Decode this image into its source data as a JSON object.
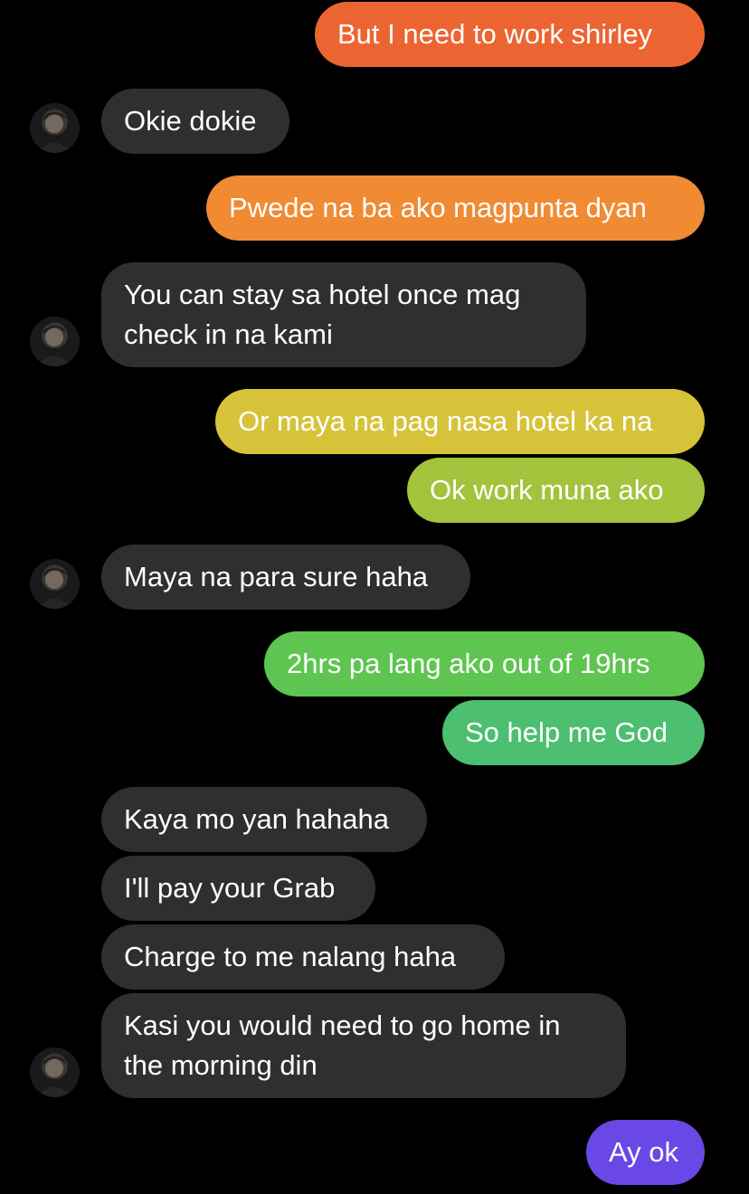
{
  "messages": [
    {
      "id": "m1",
      "from": "me",
      "text": "But I need to work shirley",
      "color": "#ec6431"
    },
    {
      "id": "m2",
      "from": "them",
      "text": "Okie dokie",
      "avatar": true
    },
    {
      "id": "m3",
      "from": "me",
      "text": "Pwede na ba ako magpunta dyan",
      "color": "#f08a33"
    },
    {
      "id": "m4",
      "from": "them",
      "text": "You can stay sa hotel once mag\ncheck in na kami",
      "avatar": true
    },
    {
      "id": "m5",
      "from": "me",
      "text": "Or maya na pag nasa hotel ka na",
      "color": "#d7c33a"
    },
    {
      "id": "m6",
      "from": "me",
      "text": "Ok work muna ako",
      "color": "#a3c33c"
    },
    {
      "id": "m7",
      "from": "them",
      "text": "Maya na para sure haha",
      "avatar": true
    },
    {
      "id": "m8",
      "from": "me",
      "text": "2hrs pa lang ako out of 19hrs",
      "color": "#5ec550"
    },
    {
      "id": "m9",
      "from": "me",
      "text": "So help me God",
      "color": "#4cbf70"
    },
    {
      "id": "m10",
      "from": "them",
      "text": "Kaya mo yan hahaha"
    },
    {
      "id": "m11",
      "from": "them",
      "text": "I'll pay your Grab"
    },
    {
      "id": "m12",
      "from": "them",
      "text": "Charge to me nalang haha"
    },
    {
      "id": "m13",
      "from": "them",
      "text": "Kasi you would need to go home in\nthe morning din",
      "avatar": true
    },
    {
      "id": "m14",
      "from": "me",
      "text": "Ay ok",
      "color": "#6a48e6"
    }
  ],
  "icons": {
    "avatar": "contact-avatar-icon"
  }
}
